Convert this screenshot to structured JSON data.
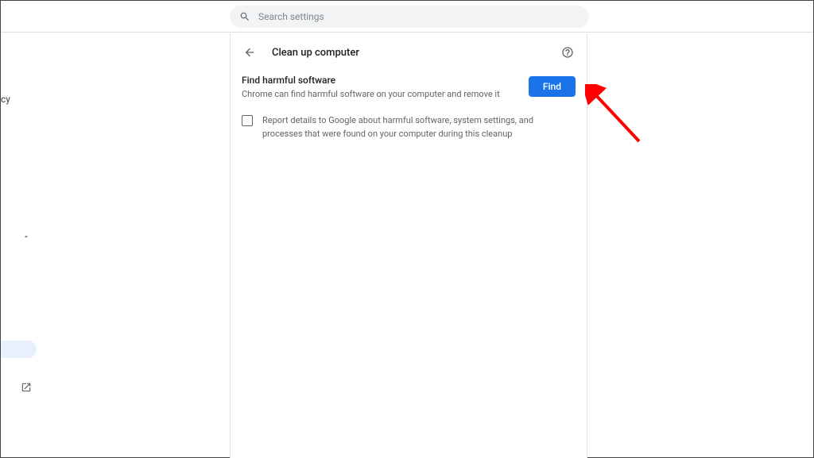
{
  "search": {
    "placeholder": "Search settings"
  },
  "sidebar": {
    "frag_text": "cy"
  },
  "page": {
    "title": "Clean up computer",
    "section": {
      "title": "Find harmful software",
      "desc": "Chrome can find harmful software on your computer and remove it",
      "button_label": "Find"
    },
    "checkbox_label": "Report details to Google about harmful software, system settings, and processes that were found on your computer during this cleanup",
    "checkbox_checked": false
  }
}
